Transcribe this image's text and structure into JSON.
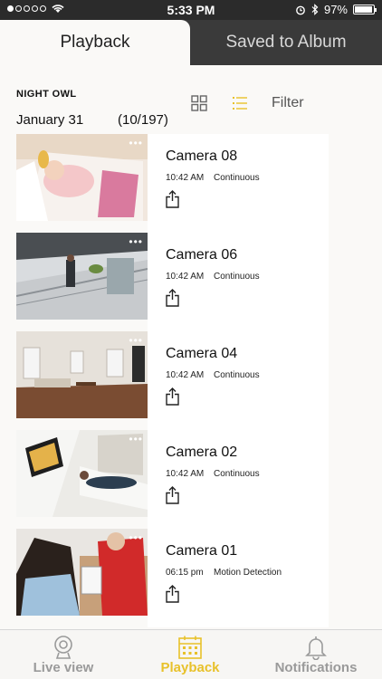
{
  "status": {
    "time": "5:33 PM",
    "battery": "97%"
  },
  "tabs": {
    "playback": "Playback",
    "saved": "Saved to Album"
  },
  "header": {
    "brand": "NIGHT OWL",
    "date": "January 31",
    "count": "(10/197)",
    "filter_label": "Filter"
  },
  "recordings": [
    {
      "camera": "Camera 08",
      "time": "10:42 AM",
      "mode": "Continuous"
    },
    {
      "camera": "Camera 06",
      "time": "10:42 AM",
      "mode": "Continuous"
    },
    {
      "camera": "Camera 04",
      "time": "10:42 AM",
      "mode": "Continuous"
    },
    {
      "camera": "Camera 02",
      "time": "10:42 AM",
      "mode": "Continuous"
    },
    {
      "camera": "Camera 01",
      "time": "06:15 pm",
      "mode": "Motion Detection"
    }
  ],
  "nav": {
    "live": "Live view",
    "playback": "Playback",
    "notifications": "Notifications"
  },
  "colors": {
    "accent": "#e8c12a",
    "dark": "#2b2b2b",
    "inactive": "#9a9a9a"
  },
  "icons": {
    "grid": "grid-view-icon",
    "list": "list-view-icon",
    "share": "share-icon",
    "live": "webcam-icon",
    "playback": "calendar-icon",
    "notifications": "bell-icon",
    "more": "more-dots-icon"
  }
}
